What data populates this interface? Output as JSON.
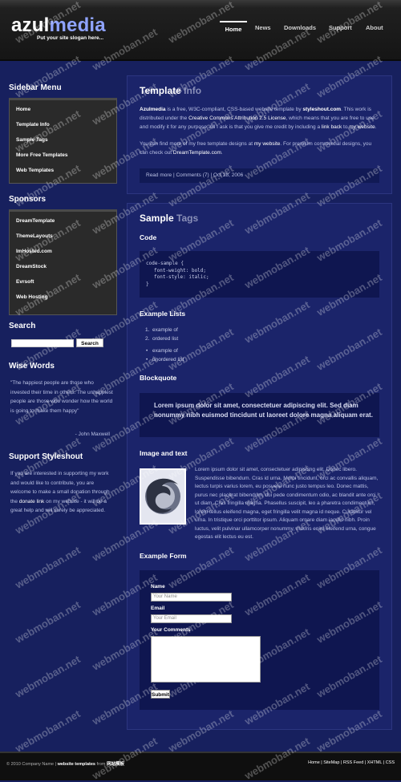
{
  "header": {
    "logo_part1": "azul",
    "logo_part2": "media",
    "slogan": "Put your site slogan here...",
    "nav": [
      "Home",
      "News",
      "Downloads",
      "Support",
      "About"
    ]
  },
  "sidebar": {
    "menu_title": "Sidebar Menu",
    "menu": [
      "Home",
      "Template Info",
      "Sample Tags",
      "More Free Templates",
      "Web Templates"
    ],
    "sponsors_title": "Sponsors",
    "sponsors": [
      "DreamTemplate",
      "ThemeLayouts",
      "ImHosted.com",
      "DreamStock",
      "Evrsoft",
      "Web Hosting"
    ],
    "search_title": "Search",
    "search_button": "Search",
    "wise_title": "Wise Words",
    "wise_quote": "\"The happiest people are those who invested their time in others. The unhappiest people are those who wonder how the world is going to make them happy\"",
    "wise_author": "- John Maxwell",
    "support_title": "Support Styleshout",
    "support_text_1": "If you are interested in supporting my work and would like to contribute, you are welcome to make a small donation through the",
    "support_link": "donate link",
    "support_text_2": "on my website - it will be a great help and will surely be appreciated."
  },
  "info": {
    "title_1": "Template",
    "title_2": "Info",
    "p1_name": "Azulmedia",
    "p1_a": "is a free, W3C-compliant, CSS-based website template by",
    "p1_author": "styleshout.com",
    "p1_b": ". This work is distributed under the",
    "p1_license": "Creative Commons Attribution 2.5 License",
    "p1_c": ", which means that you are free to use and modify it for any purpose. All I ask is that you give me credit by including a",
    "p1_link": "link back",
    "p1_d": "to",
    "p1_mywebsite": "my website",
    "p1_e": ".",
    "p2_a": "You can find more of my free template designs at",
    "p2_mywebsite": "my website",
    "p2_b": ". For premium commercial designs, you can check out",
    "p2_dt": "DreamTemplate.com",
    "p2_c": ".",
    "meta_read": "Read more",
    "meta_sep": "|",
    "meta_comments": "Comments (7)",
    "meta_date": "| Oct 28, 2006"
  },
  "tags": {
    "title_1": "Sample",
    "title_2": "Tags",
    "code_h": "Code",
    "code_lines": [
      "code-sample {",
      "font-weight: bold;",
      "font-style: italic;",
      "}"
    ],
    "lists_h": "Example Lists",
    "ol": [
      "example of",
      "ordered list"
    ],
    "ul": [
      "example of",
      "unordered list"
    ],
    "blockquote_h": "Blockquote",
    "blockquote": "Lorem ipsum dolor sit amet, consectetuer adipiscing elit. Sed diam nonummy nibh euismod tincidunt ut laoreet dolore magna aliquam erat.",
    "image_h": "Image and text",
    "image_text": "Lorem ipsum dolor sit amet, consectetuer adipiscing elit. Donec libero. Suspendisse bibendum. Cras id urna. Morbi tincidunt, orci ac convallis aliquam, lectus turpis varius lorem, eu posuere nunc justo tempus leo. Donec mattis, purus nec placerat bibendum, dui pede condimentum odio, ac blandit ante orci ut diam. Cras fringilla magna. Phasellus suscipit, leo a pharetra condimentum, lorem tellus eleifend magna, eget fringilla velit magna id neque. Curabitur vel urna. In tristique orci porttitor ipsum. Aliquam ornare diam iaculis nibh. Proin luctus, velit pulvinar ullamcorper nonummy, mauris enim eleifend urna, congue egestas elit lectus eu est.",
    "form_h": "Example Form",
    "form_name_label": "Name",
    "form_name_ph": "Your Name",
    "form_email_label": "Email",
    "form_email_ph": "Your Email",
    "form_comments_label": "Your Comments",
    "form_submit": "Submit"
  },
  "footer": {
    "left_a": "© 2010 Company Name |",
    "left_b": "website templates",
    "left_c": "from",
    "left_d": "网站模板",
    "right": "Home | SiteMap | RSS Feed | XHTML | CSS"
  },
  "watermark": "webmoban.net"
}
